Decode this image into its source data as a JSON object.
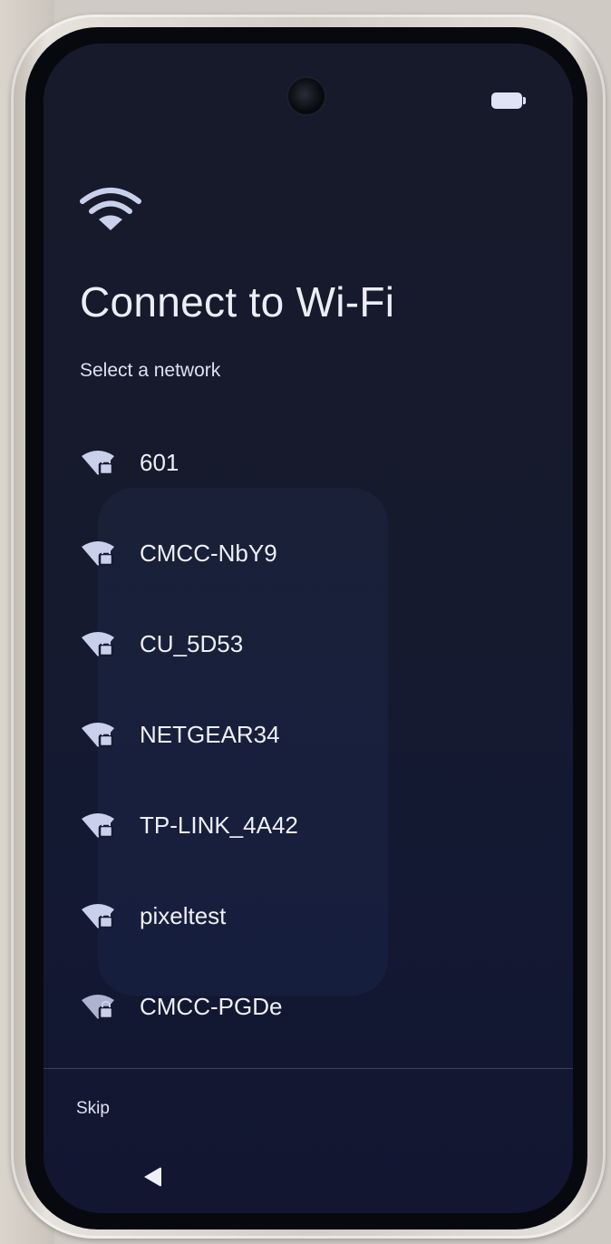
{
  "header": {
    "title": "Connect to Wi-Fi",
    "subtitle": "Select a network",
    "icon": "wifi-icon"
  },
  "status_bar": {
    "battery_icon": "battery-icon"
  },
  "networks": [
    {
      "label": "601",
      "icon": "wifi-lock-icon"
    },
    {
      "label": "CMCC-NbY9",
      "icon": "wifi-lock-icon"
    },
    {
      "label": "CU_5D53",
      "icon": "wifi-lock-icon"
    },
    {
      "label": "NETGEAR34",
      "icon": "wifi-lock-icon"
    },
    {
      "label": "TP-LINK_4A42",
      "icon": "wifi-lock-icon"
    },
    {
      "label": "pixeltest",
      "icon": "wifi-lock-icon"
    },
    {
      "label": "CMCC-PGDe",
      "icon": "wifi-lock-icon"
    }
  ],
  "footer": {
    "skip_label": "Skip"
  },
  "nav": {
    "back_icon": "back-triangle-icon"
  },
  "colors": {
    "background": "#161a2d",
    "text": "#eceef6",
    "icon": "#c9d0ec"
  }
}
